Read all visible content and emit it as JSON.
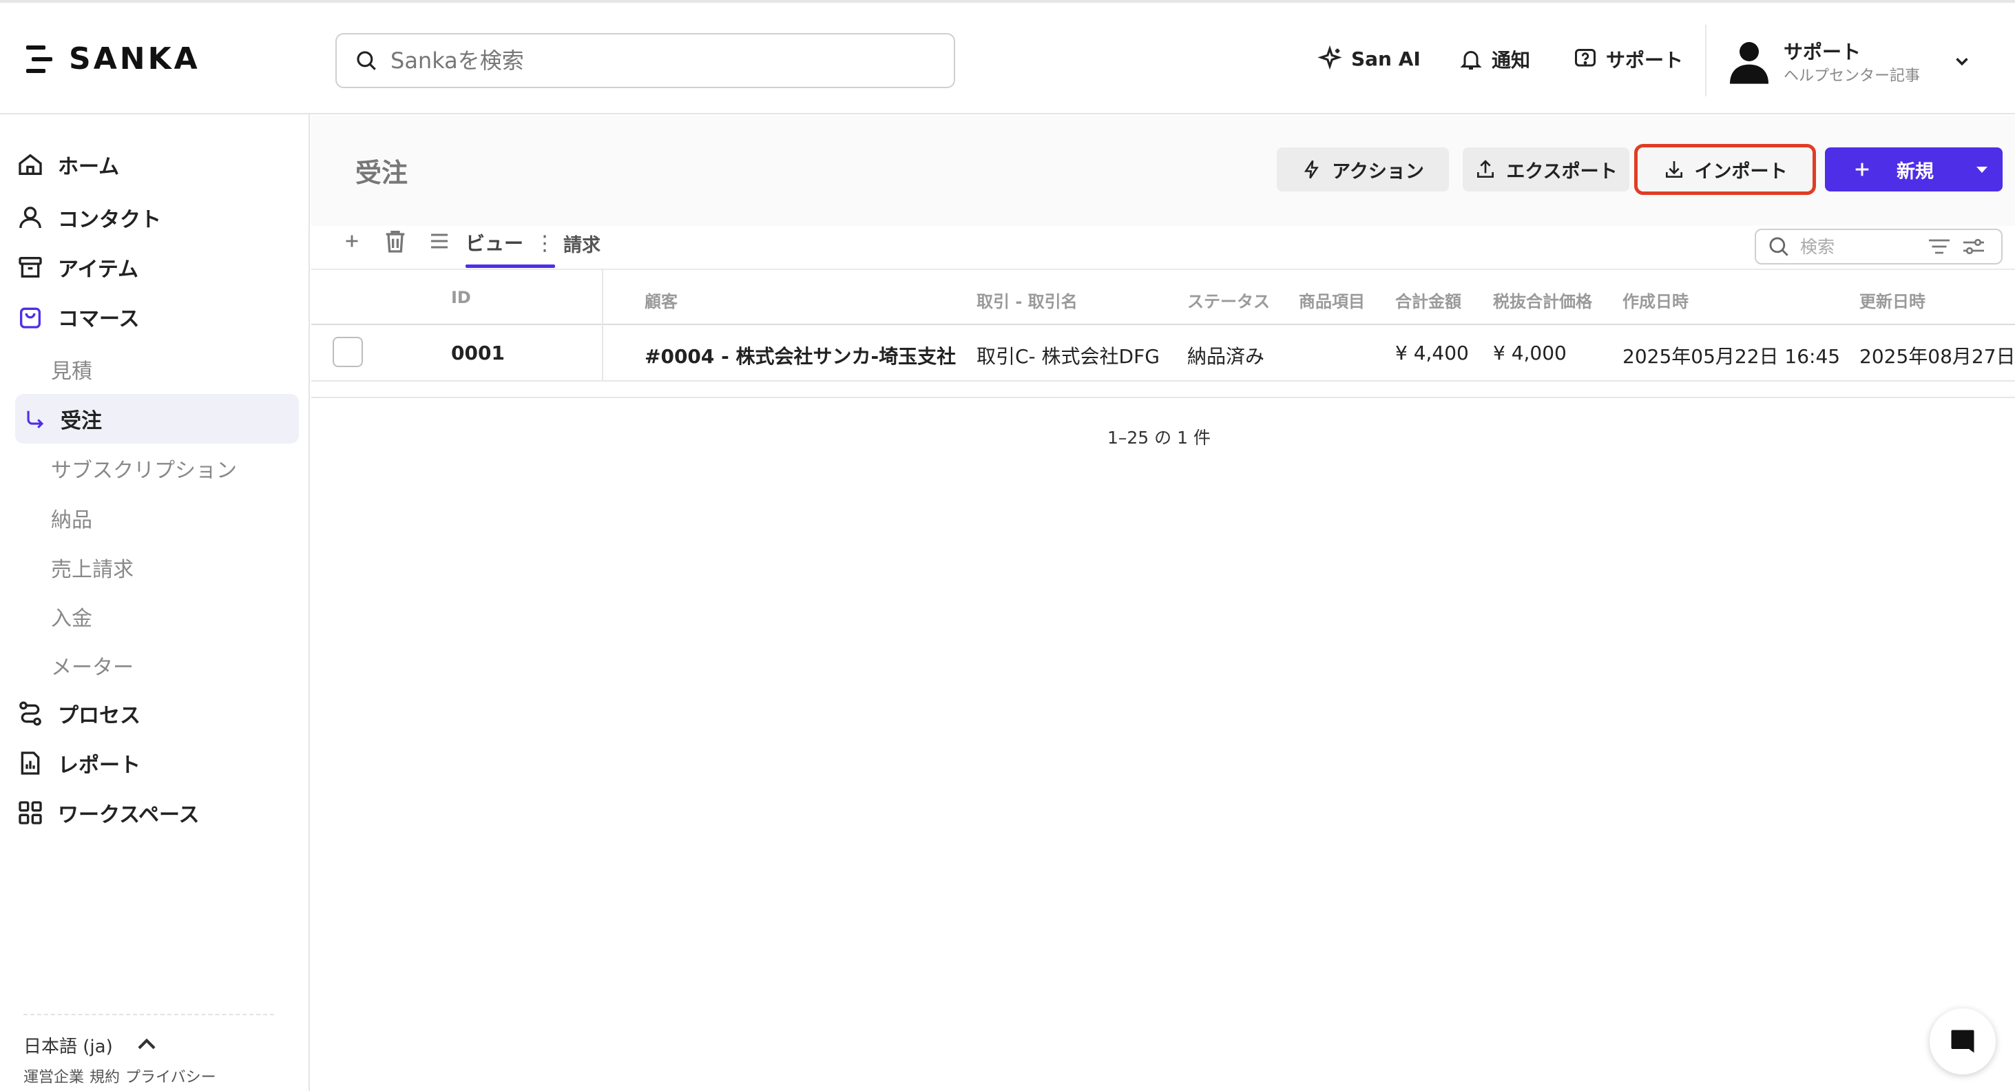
{
  "app": {
    "logo_text": "SANKA"
  },
  "header": {
    "search_placeholder": "Sankaを検索",
    "san_ai": "San AI",
    "notifications": "通知",
    "support": "サポート",
    "user_name": "サポート",
    "user_sub": "ヘルプセンター記事"
  },
  "sidebar": {
    "home": "ホーム",
    "contacts": "コンタクト",
    "items": "アイテム",
    "commerce": "コマース",
    "sub": {
      "estimates": "見積",
      "orders": "受注",
      "subscriptions": "サブスクリプション",
      "delivery": "納品",
      "sales_invoice": "売上請求",
      "payment": "入金",
      "meter": "メーター"
    },
    "process": "プロセス",
    "report": "レポート",
    "workspace": "ワークスペース",
    "language": "日本語 (ja)",
    "legal": [
      "運営企業",
      "規約",
      "プライバシー"
    ]
  },
  "main": {
    "title": "受注",
    "actions": {
      "action": "アクション",
      "export": "エクスポート",
      "import": "インポート",
      "new": "新規"
    },
    "tabs": {
      "view": "ビュー",
      "billing": "請求"
    },
    "table_search_placeholder": "検索",
    "columns": [
      "ID",
      "顧客",
      "取引 - 取引名",
      "ステータス",
      "商品項目",
      "合計金額",
      "税抜合計価格",
      "作成日時",
      "更新日時"
    ],
    "rows": [
      {
        "id": "0001",
        "customer": "#0004 - 株式会社サンカ-埼玉支社",
        "deal": "取引C- 株式会社DFG",
        "status": "納品済み",
        "items": "",
        "total": "¥ 4,400",
        "subtotal": "¥ 4,000",
        "created": "2025年05月22日 16:45",
        "updated": "2025年08月27日"
      }
    ],
    "pagination": "1–25 の 1 件"
  },
  "colors": {
    "accent": "#4f2ee8",
    "highlight": "#e03d25"
  }
}
